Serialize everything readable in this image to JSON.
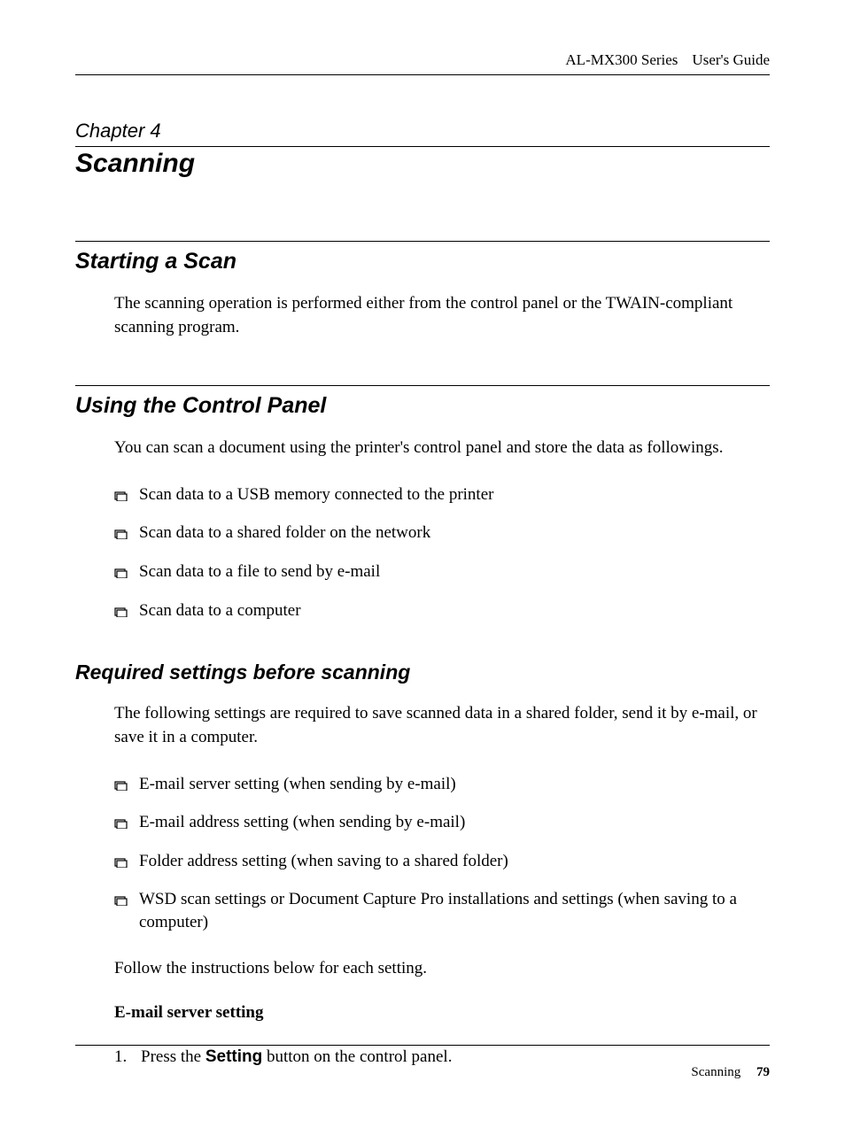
{
  "header": {
    "product": "AL-MX300 Series",
    "doc": "User's Guide"
  },
  "chapter": {
    "label": "Chapter 4",
    "title": "Scanning"
  },
  "sections": {
    "starting": {
      "heading": "Starting a Scan",
      "body": "The scanning operation is performed either from the control panel or the TWAIN-compliant scanning program."
    },
    "controlPanel": {
      "heading": "Using the Control Panel",
      "intro": "You can scan a document using the printer's control panel and store the data as followings.",
      "items": [
        "Scan data to a USB memory connected to the printer",
        "Scan data to a shared folder on the network",
        "Scan data to a file to send by e-mail",
        "Scan data to a computer"
      ]
    },
    "required": {
      "heading": "Required settings before scanning",
      "intro": "The following settings are required to save scanned data in a shared folder, send it by e-mail, or save it in a computer.",
      "items": [
        "E-mail server setting (when sending by e-mail)",
        "E-mail address setting (when sending by e-mail)",
        "Folder address setting (when saving to a shared folder)",
        "WSD scan settings or Document Capture Pro installations and settings (when saving to a computer)"
      ],
      "follow": "Follow the instructions below for each setting.",
      "sub": {
        "title": "E-mail server setting",
        "step1_pre": "Press the ",
        "step1_bold": "Setting",
        "step1_post": " button on the control panel."
      }
    }
  },
  "footer": {
    "section": "Scanning",
    "page": "79"
  }
}
